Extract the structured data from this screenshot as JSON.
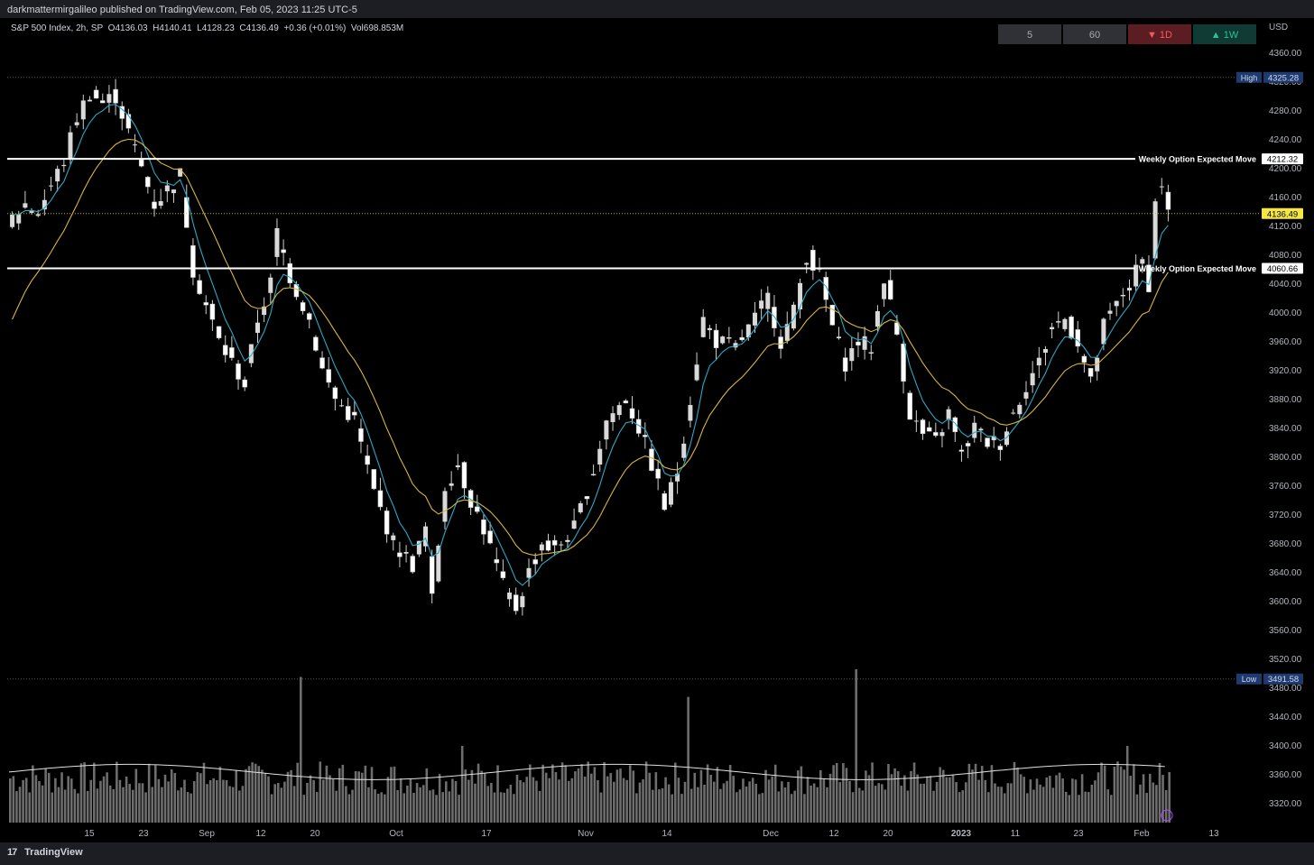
{
  "header": {
    "published": "darkmattermirgalileo published on TradingView.com, Feb 05, 2023 11:25 UTC-5"
  },
  "legend": {
    "symbol": "S&P 500 Index, 2h, SP",
    "open_label": "O",
    "open": "4136.03",
    "high_label": "H",
    "high": "4140.41",
    "low_label": "L",
    "low": "4128.23",
    "close_label": "C",
    "close": "4136.49",
    "change": "+0.36 (+0.01%)",
    "vol_label": "Vol",
    "vol": "698.853M"
  },
  "timeframes": [
    {
      "label": "5",
      "style": "neutral"
    },
    {
      "label": "60",
      "style": "neutral"
    },
    {
      "label": "▼ 1D",
      "style": "down"
    },
    {
      "label": "▲ 1W",
      "style": "up"
    }
  ],
  "footer": {
    "brand": "TradingView"
  },
  "colors": {
    "background": "#000000",
    "candle": "#d9d9d9",
    "candle_down": "#8a8a8a",
    "ema_fast": "#2aa8c7",
    "ema_slow": "#d9b53e",
    "level_line": "#ffffff",
    "price_label_bg": "#f5e642",
    "high_low_label_bg": "#1e3a6e"
  },
  "chart_data": {
    "type": "candlestick",
    "title": "S&P 500 Index, 2h, SP",
    "currency": "USD",
    "ylim": [
      3295,
      4380
    ],
    "y_ticks": [
      3320,
      3360,
      3400,
      3440,
      3480,
      3520,
      3560,
      3600,
      3640,
      3680,
      3720,
      3760,
      3800,
      3840,
      3880,
      3920,
      3960,
      4000,
      4040,
      4080,
      4120,
      4160,
      4200,
      4240,
      4280,
      4320,
      4360
    ],
    "x_ticks": [
      "15",
      "23",
      "Sep",
      "12",
      "20",
      "Oct",
      "17",
      "Nov",
      "14",
      "Dec",
      "12",
      "20",
      "2023",
      "11",
      "23",
      "Feb",
      "13"
    ],
    "price_path": [
      [
        0,
        4130
      ],
      [
        2,
        4150
      ],
      [
        4,
        4140
      ],
      [
        6,
        4175
      ],
      [
        8,
        4210
      ],
      [
        10,
        4270
      ],
      [
        12,
        4305
      ],
      [
        14,
        4290
      ],
      [
        16,
        4300
      ],
      [
        18,
        4250
      ],
      [
        20,
        4200
      ],
      [
        22,
        4150
      ],
      [
        24,
        4170
      ],
      [
        26,
        4190
      ],
      [
        28,
        4060
      ],
      [
        30,
        4010
      ],
      [
        32,
        3960
      ],
      [
        34,
        3930
      ],
      [
        36,
        3900
      ],
      [
        38,
        3990
      ],
      [
        40,
        4040
      ],
      [
        41,
        4110
      ],
      [
        43,
        4050
      ],
      [
        46,
        3990
      ],
      [
        48,
        3920
      ],
      [
        50,
        3880
      ],
      [
        53,
        3850
      ],
      [
        56,
        3750
      ],
      [
        59,
        3680
      ],
      [
        62,
        3650
      ],
      [
        64,
        3700
      ],
      [
        65,
        3600
      ],
      [
        67,
        3760
      ],
      [
        69,
        3790
      ],
      [
        71,
        3740
      ],
      [
        73,
        3700
      ],
      [
        76,
        3620
      ],
      [
        78,
        3590
      ],
      [
        80,
        3640
      ],
      [
        82,
        3680
      ],
      [
        84,
        3670
      ],
      [
        87,
        3700
      ],
      [
        90,
        3780
      ],
      [
        92,
        3850
      ],
      [
        95,
        3880
      ],
      [
        97,
        3840
      ],
      [
        99,
        3790
      ],
      [
        101,
        3730
      ],
      [
        103,
        3780
      ],
      [
        105,
        3880
      ],
      [
        107,
        3990
      ],
      [
        109,
        3960
      ],
      [
        112,
        3950
      ],
      [
        115,
        3990
      ],
      [
        117,
        4020
      ],
      [
        119,
        3960
      ],
      [
        121,
        4000
      ],
      [
        123,
        4080
      ],
      [
        125,
        4050
      ],
      [
        127,
        3980
      ],
      [
        129,
        3930
      ],
      [
        131,
        3960
      ],
      [
        133,
        3950
      ],
      [
        135,
        4050
      ],
      [
        137,
        3970
      ],
      [
        139,
        3860
      ],
      [
        141,
        3830
      ],
      [
        143,
        3820
      ],
      [
        145,
        3860
      ],
      [
        147,
        3800
      ],
      [
        149,
        3840
      ],
      [
        151,
        3820
      ],
      [
        153,
        3820
      ],
      [
        155,
        3860
      ],
      [
        157,
        3900
      ],
      [
        159,
        3930
      ],
      [
        161,
        3980
      ],
      [
        163,
        3990
      ],
      [
        165,
        3960
      ],
      [
        167,
        3900
      ],
      [
        169,
        3980
      ],
      [
        171,
        4010
      ],
      [
        173,
        4040
      ],
      [
        175,
        4070
      ],
      [
        176,
        4040
      ],
      [
        177,
        4150
      ],
      [
        178,
        4180
      ],
      [
        179,
        4136
      ]
    ],
    "series": [
      {
        "name": "EMA fast",
        "values_ref": "price_path"
      },
      {
        "name": "EMA slow",
        "values_ref": "price_path"
      }
    ],
    "levels": [
      {
        "label": "Weekly Option Expected Move",
        "value": "4212.32"
      },
      {
        "label": "Weekly Option Expected Move",
        "value": "4060.66"
      }
    ],
    "last_price": "4136.49",
    "high": {
      "label": "High",
      "value": "4325.28"
    },
    "low": {
      "label": "Low",
      "value": "3491.58"
    },
    "volume_spikes": [
      {
        "bar": 45,
        "level": 0.95
      },
      {
        "bar": 105,
        "level": 0.82
      },
      {
        "bar": 131,
        "level": 1.0
      },
      {
        "bar": 70,
        "level": 0.5
      },
      {
        "bar": 173,
        "level": 0.5
      }
    ]
  }
}
